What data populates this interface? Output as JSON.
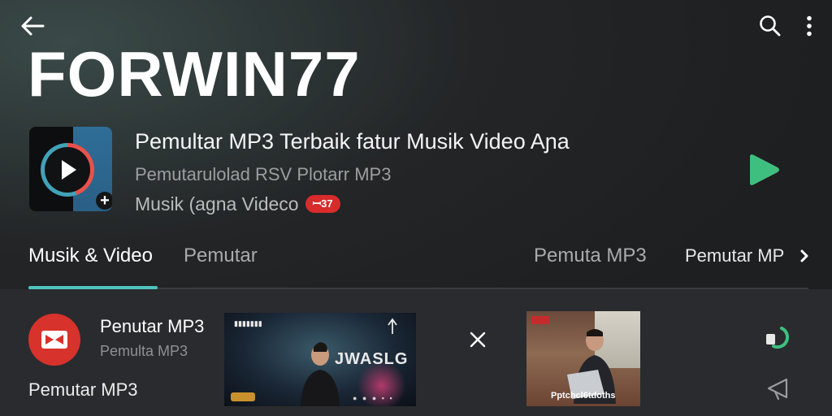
{
  "header": {
    "brand": "FORWIN77"
  },
  "app": {
    "title": "Pemultar MP3 Terbaik fatur Musik Video Aɲa",
    "subtitle_1": "Pemutarulolad RSV Plotarr MP3",
    "subtitle_2": "Musik (agna Videco",
    "badge": "ꟷ37"
  },
  "tabs": [
    {
      "label": "Musik & Video",
      "active": true
    },
    {
      "label": "Pemutar",
      "active": false
    },
    {
      "label": "Pemuta MP3",
      "active": false
    },
    {
      "label": "Pemutar MP",
      "active": false
    }
  ],
  "bottom": {
    "row_title": "Penutar MP3",
    "row_subtitle": "Pemulta MP3",
    "caption": "Pemutar MP3",
    "thumb1_overlay": "JWASLG",
    "thumb2_caption": "Pptchcl6tdoths"
  },
  "colors": {
    "accent": "#4fc4bf",
    "play_green": "#3fbf7f",
    "badge_red": "#d82b2b",
    "logo_red": "#d7322c"
  },
  "icons": [
    "back-arrow-icon",
    "search-icon",
    "more-vert-icon",
    "play-icon",
    "chevron-right-icon",
    "close-icon",
    "sync-icon",
    "cast-icon"
  ]
}
